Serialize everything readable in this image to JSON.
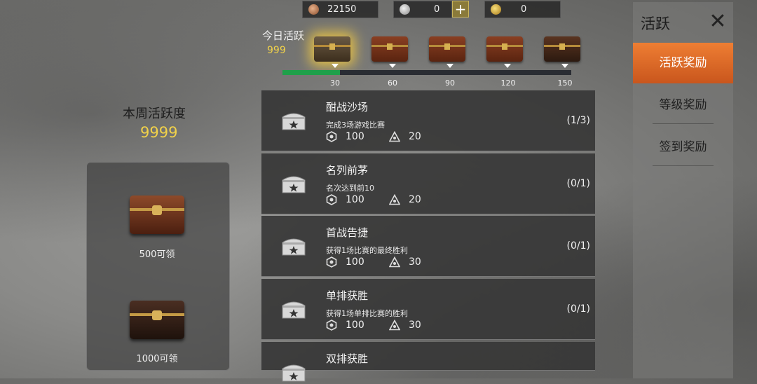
{
  "currency": {
    "copper": "22150",
    "silver": "0",
    "gold": "0"
  },
  "daily": {
    "title": "今日活跃",
    "value": "999",
    "progress": 0.2,
    "milestones": [
      "30",
      "60",
      "90",
      "120",
      "150"
    ]
  },
  "weekly": {
    "title": "本周活跃度",
    "value": "9999",
    "rewards": [
      {
        "label": "500可领"
      },
      {
        "label": "1000可领"
      }
    ]
  },
  "tasks": [
    {
      "name": "酣战沙场",
      "desc": "完成3场游戏比赛",
      "reward1": "100",
      "reward2": "20",
      "progress": "(1/3)"
    },
    {
      "name": "名列前茅",
      "desc": "名次达到前10",
      "reward1": "100",
      "reward2": "20",
      "progress": "(0/1)"
    },
    {
      "name": "首战告捷",
      "desc": "获得1场比赛的最终胜利",
      "reward1": "100",
      "reward2": "30",
      "progress": "(0/1)"
    },
    {
      "name": "单排获胜",
      "desc": "获得1场单排比赛的胜利",
      "reward1": "100",
      "reward2": "30",
      "progress": "(0/1)"
    },
    {
      "name": "双排获胜",
      "desc": "",
      "reward1": "",
      "reward2": "",
      "progress": ""
    }
  ],
  "side": {
    "title": "活跃",
    "tabs": [
      "活跃奖励",
      "等级奖励",
      "签到奖励"
    ]
  }
}
